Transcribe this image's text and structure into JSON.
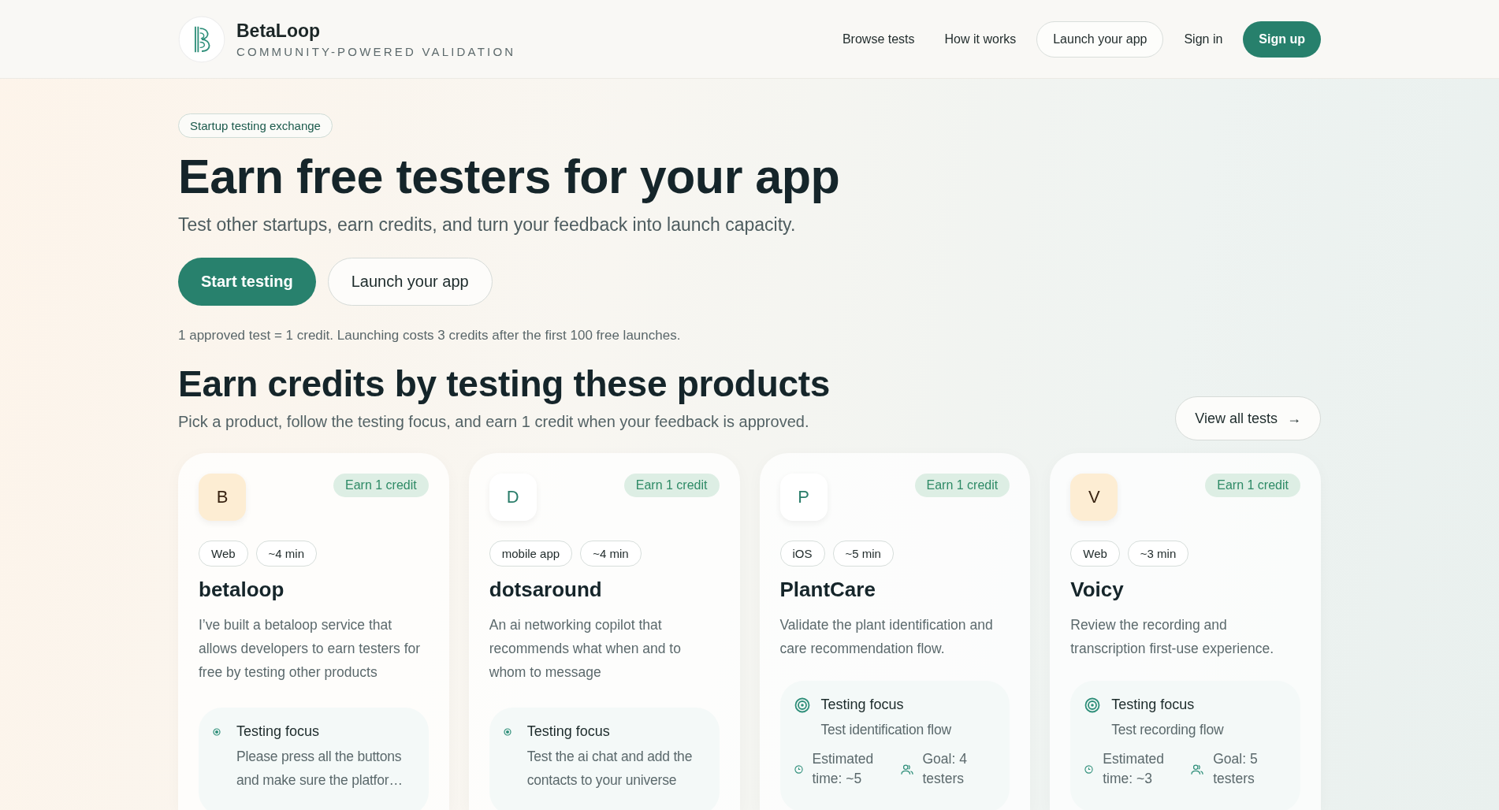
{
  "header": {
    "brand": "BetaLoop",
    "tagline": "COMMUNITY-POWERED VALIDATION",
    "nav": [
      {
        "label": "Browse tests",
        "kind": "link"
      },
      {
        "label": "How it works",
        "kind": "link"
      },
      {
        "label": "Launch your app",
        "kind": "outline"
      },
      {
        "label": "Sign in",
        "kind": "link"
      },
      {
        "label": "Sign up",
        "kind": "primary"
      }
    ]
  },
  "hero": {
    "badge": "Startup testing exchange",
    "title": "Earn free testers for your app",
    "subtitle": "Test other startups, earn credits, and turn your feedback into launch capacity.",
    "buttons": [
      {
        "label": "Start testing",
        "kind": "primary"
      },
      {
        "label": "Launch your app",
        "kind": "outline"
      }
    ],
    "note": "1 approved test = 1 credit. Launching costs 3 credits after the first 100 free launches."
  },
  "section": {
    "title": "Earn credits by testing these products",
    "subtitle": "Pick a product, follow the testing focus, and earn 1 credit when your feedback is approved.",
    "view_all": "View all tests",
    "arrow": "→"
  },
  "products": [
    {
      "avatar": {
        "initial": "B",
        "kind": "warm"
      },
      "reward": "Earn 1 credit",
      "tags": [
        "Web",
        "~4 min"
      ],
      "name": "betaloop",
      "description": "I’ve built a betaloop service that allows developers to earn testers for free by testing other products",
      "focus": {
        "kind": "brief",
        "title": "Testing focus",
        "text": "Please press all the buttons and make sure the platfor…"
      }
    },
    {
      "avatar": {
        "initial": "D",
        "kind": "plain"
      },
      "reward": "Earn 1 credit",
      "tags": [
        "mobile app",
        "~4 min"
      ],
      "name": "dotsaround",
      "description": "An ai networking copilot that recommends what when and to whom to message",
      "focus": {
        "kind": "brief",
        "title": "Testing focus",
        "text": "Test the ai chat and add the contacts to your universe"
      }
    },
    {
      "avatar": {
        "initial": "P",
        "kind": "plain"
      },
      "reward": "Earn 1 credit",
      "tags": [
        "iOS",
        "~5 min"
      ],
      "name": "PlantCare",
      "description": "Validate the plant identification and care recommendation flow.",
      "focus": {
        "kind": "detailed",
        "title": "Testing focus",
        "text": "Test identification flow",
        "time": "Estimated time: ~5",
        "goal": "Goal: 4 testers"
      }
    },
    {
      "avatar": {
        "initial": "V",
        "kind": "warm"
      },
      "reward": "Earn 1 credit",
      "tags": [
        "Web",
        "~3 min"
      ],
      "name": "Voicy",
      "description": "Review the recording and transcription first-use experience.",
      "focus": {
        "kind": "detailed",
        "title": "Testing focus",
        "text": "Test recording flow",
        "time": "Estimated time: ~3",
        "goal": "Goal: 5 testers"
      }
    }
  ]
}
